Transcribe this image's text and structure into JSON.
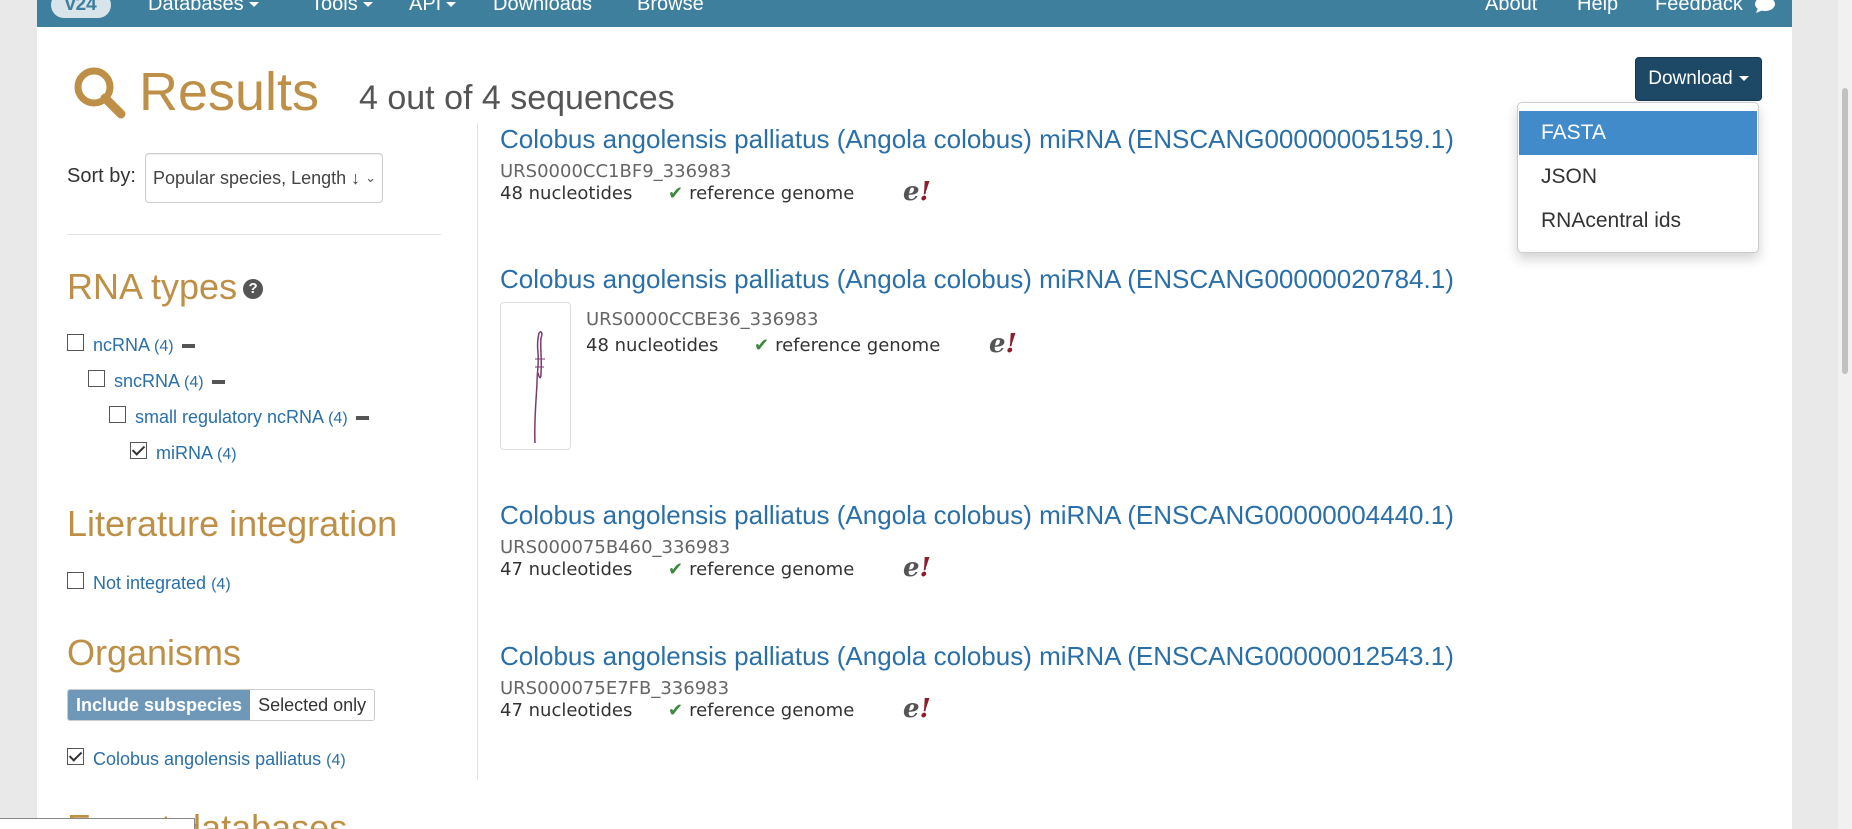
{
  "nav": {
    "version": "v24",
    "databases": "Databases",
    "tools": "Tools",
    "api": "API",
    "downloads": "Downloads",
    "browse": "Browse",
    "about": "About",
    "help": "Help",
    "feedback": "Feedback"
  },
  "header": {
    "title": "Results",
    "count": "4 out of 4 sequences"
  },
  "download": {
    "label": "Download",
    "options": [
      "FASTA",
      "JSON",
      "RNAcentral ids"
    ],
    "active": "FASTA"
  },
  "sort": {
    "label": "Sort by:",
    "value": "Popular species, Length ↓"
  },
  "facets": {
    "rna_types": {
      "heading": "RNA types",
      "items": [
        {
          "label": "ncRNA",
          "count": "(4)",
          "checked": false
        },
        {
          "label": "sncRNA",
          "count": "(4)",
          "checked": false
        },
        {
          "label": "small regulatory ncRNA",
          "count": "(4)",
          "checked": false
        },
        {
          "label": "miRNA",
          "count": "(4)",
          "checked": true
        }
      ]
    },
    "literature": {
      "heading": "Literature integration",
      "items": [
        {
          "label": "Not integrated",
          "count": "(4)",
          "checked": false
        }
      ]
    },
    "organisms": {
      "heading": "Organisms",
      "include_subspecies": "Include subspecies",
      "selected_only": "Selected only",
      "items": [
        {
          "label": "Colobus angolensis palliatus",
          "count": "(4)",
          "checked": true
        }
      ]
    },
    "expert_heading": "Expert databases"
  },
  "results": [
    {
      "title": "Colobus angolensis palliatus (Angola colobus) miRNA (ENSCANG00000005159.1)",
      "id": "URS0000CC1BF9_336983",
      "length": "48 nucleotides",
      "ref": "reference genome"
    },
    {
      "title": "Colobus angolensis palliatus (Angola colobus) miRNA (ENSCANG00000020784.1)",
      "id": "URS0000CCBE36_336983",
      "length": "48 nucleotides",
      "ref": "reference genome"
    },
    {
      "title": "Colobus angolensis palliatus (Angola colobus) miRNA (ENSCANG00000004440.1)",
      "id": "URS000075B460_336983",
      "length": "47 nucleotides",
      "ref": "reference genome"
    },
    {
      "title": "Colobus angolensis palliatus (Angola colobus) miRNA (ENSCANG00000012543.1)",
      "id": "URS000075E7FB_336983",
      "length": "47 nucleotides",
      "ref": "reference genome"
    }
  ],
  "ensembl_logo": {
    "e": "e",
    "bang": "!"
  },
  "colors": {
    "navbar": "#3e7f9e",
    "heading_gold": "#be9047",
    "link_blue": "#2a6fa8",
    "download_btn": "#1e4966",
    "menu_active": "#428bca"
  }
}
